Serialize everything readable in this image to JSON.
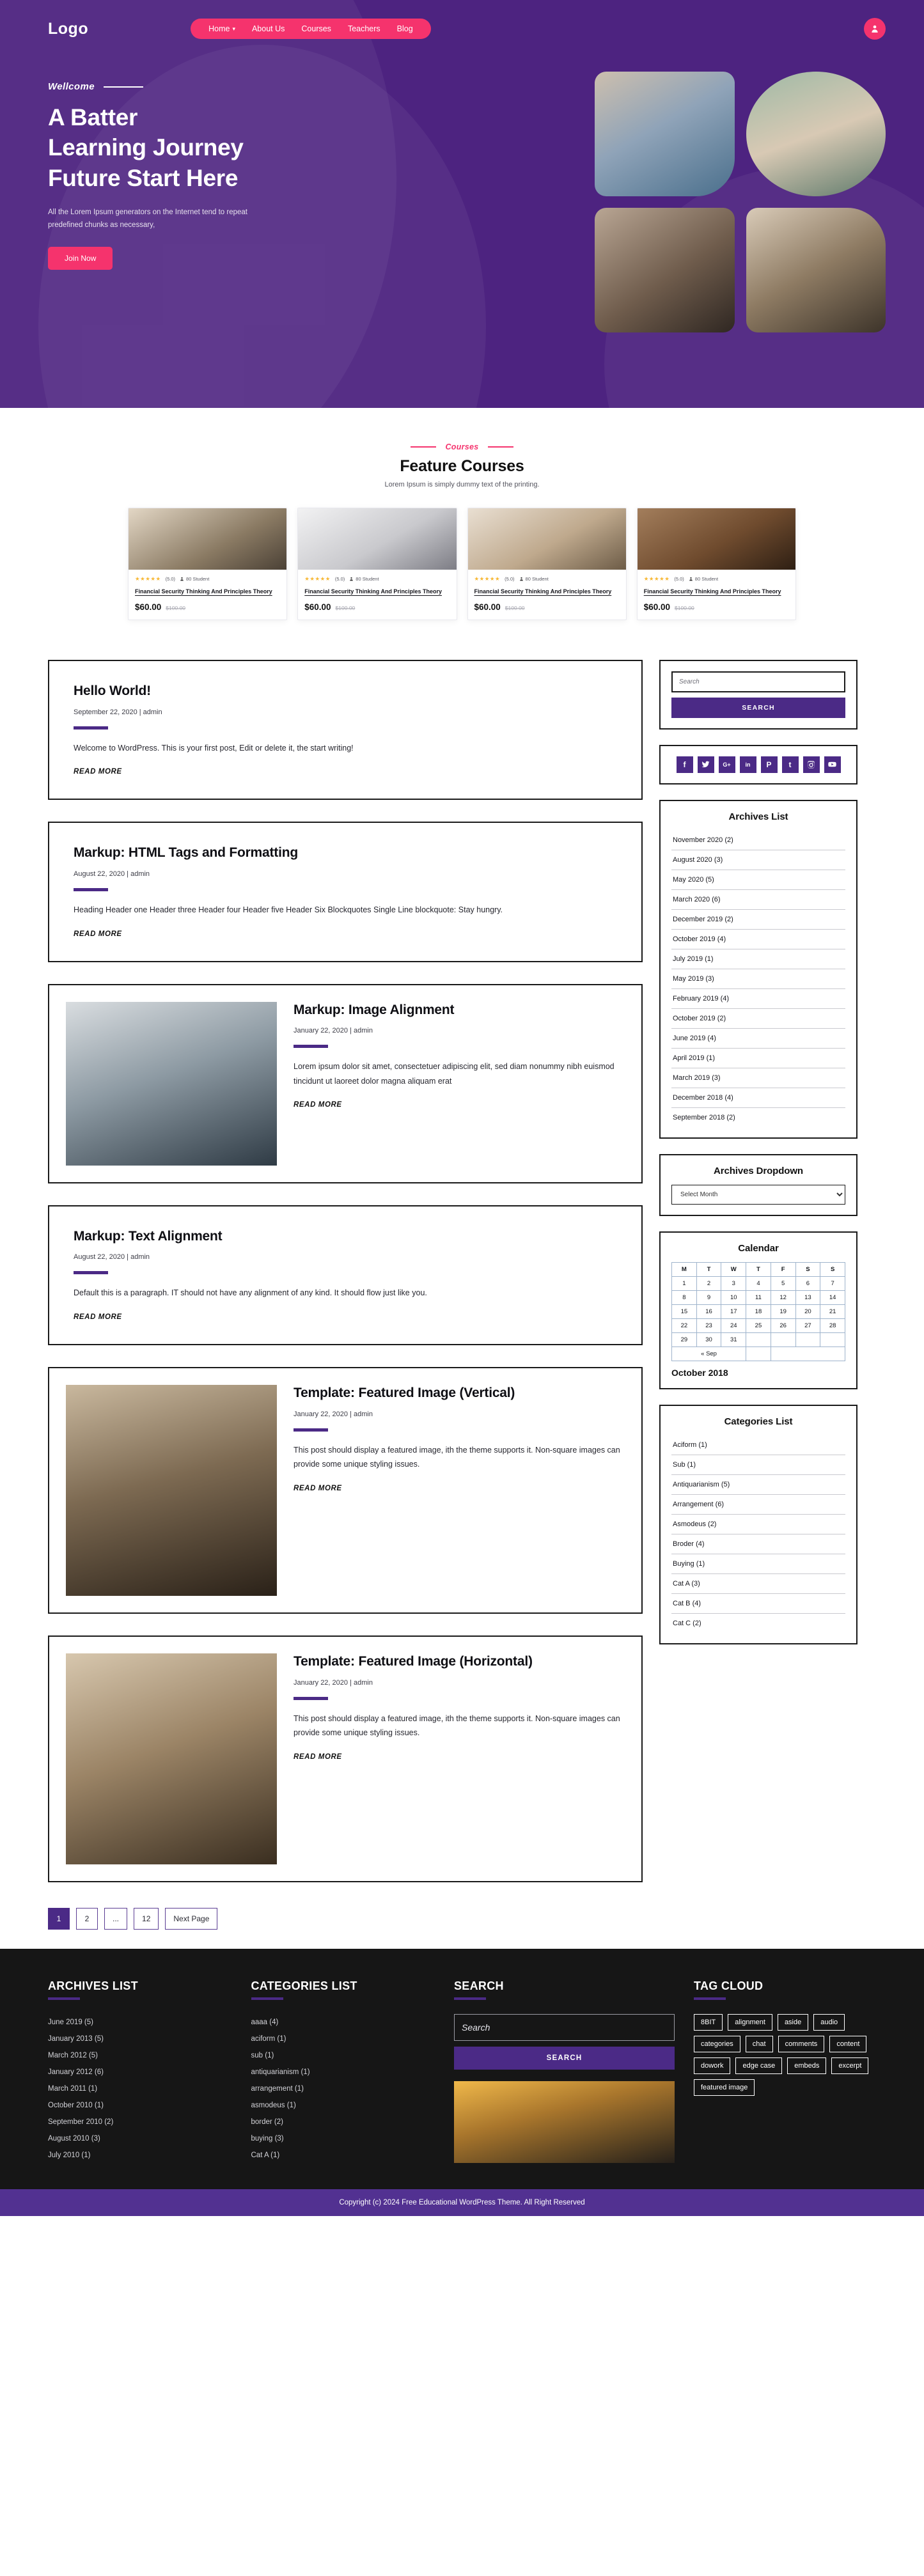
{
  "header": {
    "logo": "Logo",
    "nav": [
      {
        "label": "Home",
        "has_dropdown": true
      },
      {
        "label": "About Us",
        "has_dropdown": false
      },
      {
        "label": "Courses",
        "has_dropdown": false
      },
      {
        "label": "Teachers",
        "has_dropdown": false
      },
      {
        "label": "Blog",
        "has_dropdown": false
      }
    ],
    "account_icon": "user-icon"
  },
  "hero": {
    "eyebrow": "Wellcome",
    "title_line1": "A Batter",
    "title_line2": "Learning Journey",
    "title_line3": "Future Start Here",
    "paragraph": "All the Lorem Ipsum generators on the Internet tend to repeat predefined chunks as necessary,",
    "cta": "Join Now",
    "bg_color": "#4d2380",
    "accent_color": "#f5336d"
  },
  "courses": {
    "eyebrow": "Courses",
    "title": "Feature Courses",
    "subtitle": "Lorem Ipsum is simply dummy text of the printing.",
    "items": [
      {
        "stars": "★★★★★",
        "rating": "(5.0)",
        "students": "80 Student",
        "title": "Financial Security Thinking And Principles Theory",
        "price": "$60.00",
        "old_price": "$100.00"
      },
      {
        "stars": "★★★★★",
        "rating": "(5.0)",
        "students": "80 Student",
        "title": "Financial Security Thinking And Principles Theory",
        "price": "$60.00",
        "old_price": "$100.00"
      },
      {
        "stars": "★★★★★",
        "rating": "(5.0)",
        "students": "80 Student",
        "title": "Financial Security Thinking And Principles Theory",
        "price": "$60.00",
        "old_price": "$100.00"
      },
      {
        "stars": "★★★★★",
        "rating": "(5.0)",
        "students": "80 Student",
        "title": "Financial Security Thinking And Principles Theory",
        "price": "$60.00",
        "old_price": "$100.00"
      }
    ]
  },
  "posts": [
    {
      "title": "Hello World!",
      "byline": "September 22, 2020 | admin",
      "excerpt": "Welcome to WordPress. This is your first post, Edit or delete it, the start writing!",
      "read_more": "READ MORE",
      "has_image": false
    },
    {
      "title": "Markup: HTML Tags and Formatting",
      "byline": "August 22, 2020 | admin",
      "excerpt": "Heading Header one Header three Header four Header five Header Six Blockquotes Single Line blockquote: Stay hungry.",
      "read_more": "READ MORE",
      "has_image": false
    },
    {
      "title": "Markup: Image Alignment",
      "byline": "January 22, 2020 | admin",
      "excerpt": "Lorem ipsum dolor sit amet, consectetuer adipiscing elit, sed diam nonummy nibh euismod tincidunt ut laoreet dolor magna aliquam erat",
      "read_more": "READ MORE",
      "has_image": true
    },
    {
      "title": "Markup: Text Alignment",
      "byline": "August 22, 2020 | admin",
      "excerpt": "Default this is a paragraph. IT should not have any alignment of any kind. It should flow just like you.",
      "read_more": "READ MORE",
      "has_image": false
    },
    {
      "title": "Template: Featured Image (Vertical)",
      "byline": "January 22, 2020 | admin",
      "excerpt": "This post should display a featured image, ith the theme supports it. Non-square images can provide some unique styling issues.",
      "read_more": "READ MORE",
      "has_image": true
    },
    {
      "title": "Template: Featured Image (Horizontal)",
      "byline": "January 22, 2020 | admin",
      "excerpt": "This post should display a featured image, ith the theme supports it. Non-square images can provide some unique styling issues.",
      "read_more": "READ MORE",
      "has_image": true
    }
  ],
  "pagination": [
    "1",
    "2",
    "...",
    "12",
    "Next Page"
  ],
  "sidebar": {
    "search": {
      "placeholder": "Search",
      "button": "SEARCH"
    },
    "socials": [
      {
        "name": "facebook-icon",
        "glyph": "f"
      },
      {
        "name": "twitter-icon",
        "glyph": "t"
      },
      {
        "name": "google-plus-icon",
        "glyph": "G+"
      },
      {
        "name": "linkedin-icon",
        "glyph": "in"
      },
      {
        "name": "pinterest-icon",
        "glyph": "P"
      },
      {
        "name": "tumblr-icon",
        "glyph": "t"
      },
      {
        "name": "instagram-icon",
        "glyph": "o"
      },
      {
        "name": "youtube-icon",
        "glyph": "▶"
      }
    ],
    "archives_title": "Archives List",
    "archives": [
      "November 2020 (2)",
      "August 2020 (3)",
      "May 2020 (5)",
      "March 2020 (6)",
      "December 2019 (2)",
      "October 2019 (4)",
      "July 2019 (1)",
      "May 2019 (3)",
      "February 2019 (4)",
      "October 2019 (2)",
      "June 2019 (4)",
      "April 2019 (1)",
      "March 2019 (3)",
      "December 2018 (4)",
      "September 2018 (2)"
    ],
    "archives_dropdown_title": "Archives Dropdown",
    "archives_dropdown_value": "Select Month",
    "calendar_title": "Calendar",
    "calendar": {
      "weekdays": [
        "M",
        "T",
        "W",
        "T",
        "F",
        "S",
        "S"
      ],
      "weeks": [
        [
          "1",
          "2",
          "3",
          "4",
          "5",
          "6",
          "7"
        ],
        [
          "8",
          "9",
          "10",
          "11",
          "12",
          "13",
          "14"
        ],
        [
          "15",
          "16",
          "17",
          "18",
          "19",
          "20",
          "21"
        ],
        [
          "22",
          "23",
          "24",
          "25",
          "26",
          "27",
          "28"
        ],
        [
          "29",
          "30",
          "31",
          "",
          "",
          "",
          ""
        ]
      ],
      "prev": "« Sep",
      "month_label": "October 2018"
    },
    "categories_title": "Categories List",
    "categories": [
      "Aciform (1)",
      "Sub (1)",
      "Antiquarianism (5)",
      "Arrangement (6)",
      "Asmodeus (2)",
      "Broder (4)",
      "Buying (1)",
      "Cat A (3)",
      "Cat B (4)",
      "Cat C (2)"
    ]
  },
  "footer": {
    "archives_title": "ARCHIVES LIST",
    "archives": [
      "June 2019 (5)",
      "January  2013 (5)",
      "March 2012 (5)",
      "January  2012 (6)",
      "March  2011 (1)",
      "October 2010 (1)",
      "September 2010 (2)",
      "August 2010 (3)",
      "July 2010 (1)"
    ],
    "categories_title": "CATEGORIES LIST",
    "categories": [
      "aaaa (4)",
      "aciform (1)",
      "sub (1)",
      "antiquarianism (1)",
      "arrangement (1)",
      "asmodeus (1)",
      "border (2)",
      "buying (3)",
      "Cat A (1)"
    ],
    "search_title": "SEARCH",
    "search_placeholder": "Search",
    "search_button": "SEARCH",
    "tag_cloud_title": "TAG CLOUD",
    "tags": [
      "8BIT",
      "alignment",
      "aside",
      "audio",
      "categories",
      "chat",
      "comments",
      "content",
      "dowork",
      "edge case",
      "embeds",
      "excerpt",
      "featured image"
    ],
    "copyright": "Copyright (c) 2024 Free Educational WordPress Theme. All Right Reserved",
    "accent_color": "#4b2a86",
    "bg_color": "#161616",
    "copyright_bg": "#523191"
  }
}
